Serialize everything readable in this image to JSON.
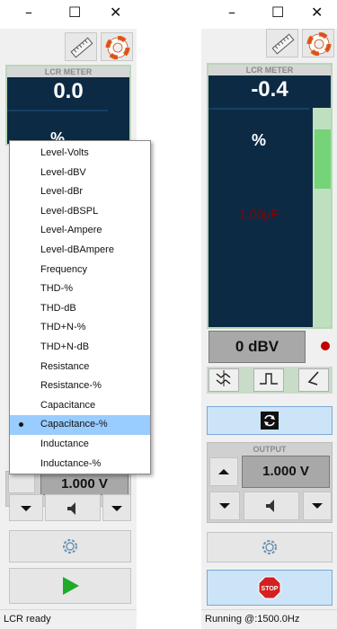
{
  "left_panel": {
    "window_controls": {
      "minimize": "–",
      "maximize": "☐",
      "close": "✕"
    },
    "meter": {
      "title": "LCR METER",
      "value": "0.0",
      "unit": "%"
    },
    "output": {
      "value": "1.000 V"
    },
    "status": "LCR ready",
    "dropdown": {
      "items": [
        "Level-Volts",
        "Level-dBV",
        "Level-dBr",
        "Level-dBSPL",
        "Level-Ampere",
        "Level-dBAmpere",
        "Frequency",
        "THD-%",
        "THD-dB",
        "THD+N-%",
        "THD+N-dB",
        "Resistance",
        "Resistance-%",
        "Capacitance",
        "Capacitance-%",
        "Inductance",
        "Inductance-%"
      ],
      "selected": "Capacitance-%"
    }
  },
  "right_panel": {
    "window_controls": {
      "minimize": "–",
      "maximize": "☐",
      "close": "✕"
    },
    "meter": {
      "title": "LCR METER",
      "value": "-0.4",
      "unit": "%",
      "reading": "1.00µF",
      "level_fraction": 0.45
    },
    "range": "0 dBV",
    "output": {
      "title": "OUTPUT",
      "value": "1.000 V"
    },
    "status": "Running @:1500.0Hz"
  },
  "colors": {
    "meter_bg": "#0d2a44",
    "level_green": "#74d477",
    "reading_red": "#8b0000",
    "selected_blue": "#99ccff",
    "run_green": "#1faa2a",
    "stop_red": "#d42020"
  },
  "icons": [
    "ruler-icon",
    "lifebuoy-icon",
    "averaging-icon",
    "pulse-icon",
    "probe-icon",
    "cycle-icon",
    "arrow-up-icon",
    "arrow-down-icon",
    "speaker-icon",
    "gear-icon",
    "play-icon",
    "stop-icon"
  ]
}
